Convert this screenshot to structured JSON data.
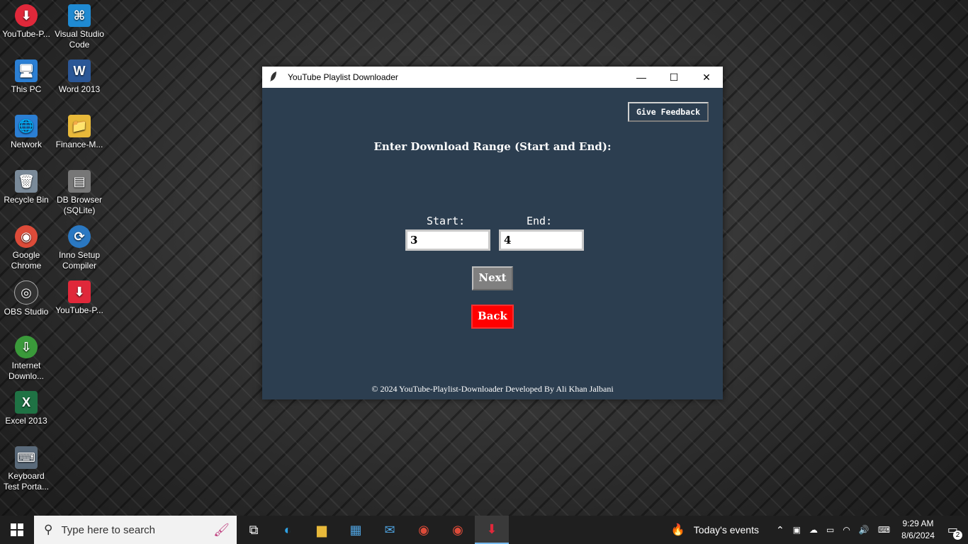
{
  "desktop": {
    "icons": [
      {
        "label": "YouTube-P...",
        "glyph": "⬇",
        "color": "#e0283a"
      },
      {
        "label": "Visual Studio Code",
        "glyph": "⌘",
        "color": "#1f8ad2"
      },
      {
        "label": "This PC",
        "glyph": "🖥",
        "color": "#2b7fd4"
      },
      {
        "label": "Word 2013",
        "glyph": "W",
        "color": "#2b5797"
      },
      {
        "label": "Network",
        "glyph": "🌐",
        "color": "#2b7fd4"
      },
      {
        "label": "Finance-M...",
        "glyph": "📁",
        "color": "#e8b93a"
      },
      {
        "label": "Recycle Bin",
        "glyph": "🗑",
        "color": "#7a8a99"
      },
      {
        "label": "DB Browser (SQLite)",
        "glyph": "▤",
        "color": "#777777"
      },
      {
        "label": "Google Chrome",
        "glyph": "◉",
        "color": "#dd4b39"
      },
      {
        "label": "Inno Setup Compiler",
        "glyph": "⟳",
        "color": "#2a78c2"
      },
      {
        "label": "OBS Studio",
        "glyph": "◎",
        "color": "#333333"
      },
      {
        "label": "YouTube-P...",
        "glyph": "⬇",
        "color": "#e0283a"
      },
      {
        "label": "Internet Downlo...",
        "glyph": "⇩",
        "color": "#3a9a3a"
      },
      {
        "label": "Excel 2013",
        "glyph": "X",
        "color": "#1f7244"
      },
      {
        "label": "Keyboard Test Porta...",
        "glyph": "⌨",
        "color": "#5a6a7a"
      }
    ]
  },
  "window": {
    "title": "YouTube Playlist Downloader",
    "minimize": "—",
    "maximize": "☐",
    "close": "✕"
  },
  "app": {
    "feedback_label": "Give Feedback",
    "heading": "Enter Download Range (Start and End):",
    "start_label": "Start:",
    "start_value": "3",
    "end_label": "End:",
    "end_value": "4",
    "next_label": "Next",
    "back_label": "Back",
    "footer": "© 2024 YouTube-Playlist-Downloader Developed By Ali Khan Jalbani",
    "colors": {
      "background": "#2c3e50",
      "next": "#808080",
      "back": "#ff0000"
    }
  },
  "taskbar": {
    "search_placeholder": "Type here to search",
    "news": "Today's events",
    "time": "9:29 AM",
    "date": "8/6/2024",
    "notifications": "2"
  }
}
